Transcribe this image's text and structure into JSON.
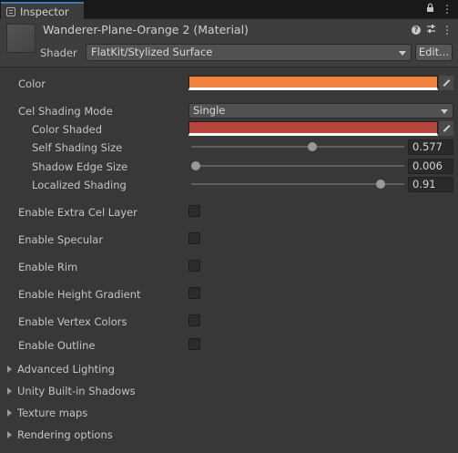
{
  "window": {
    "tab_label": "Inspector"
  },
  "header": {
    "material_name": "Wanderer-Plane-Orange 2 (Material)",
    "shader_label": "Shader",
    "shader_value": "FlatKit/Stylized Surface",
    "edit_label": "Edit..."
  },
  "props": {
    "color_label": "Color",
    "color_value": "#f2813b",
    "cel_mode_label": "Cel Shading Mode",
    "cel_mode_value": "Single",
    "color_shaded_label": "Color Shaded",
    "color_shaded_value": "#b8453a",
    "self_shading_label": "Self Shading Size",
    "self_shading_value": "0.577",
    "shadow_edge_label": "Shadow Edge Size",
    "shadow_edge_value": "0.006",
    "localized_label": "Localized Shading",
    "localized_value": "0.91"
  },
  "toggles": [
    {
      "label": "Enable Extra Cel Layer",
      "checked": false
    },
    {
      "label": "Enable Specular",
      "checked": false
    },
    {
      "label": "Enable Rim",
      "checked": false
    },
    {
      "label": "Enable Height Gradient",
      "checked": false
    },
    {
      "label": "Enable Vertex Colors",
      "checked": false
    },
    {
      "label": "Enable Outline",
      "checked": false
    }
  ],
  "foldouts": [
    {
      "label": "Advanced Lighting"
    },
    {
      "label": "Unity Built-in Shadows"
    },
    {
      "label": "Texture maps"
    },
    {
      "label": "Rendering options"
    }
  ]
}
